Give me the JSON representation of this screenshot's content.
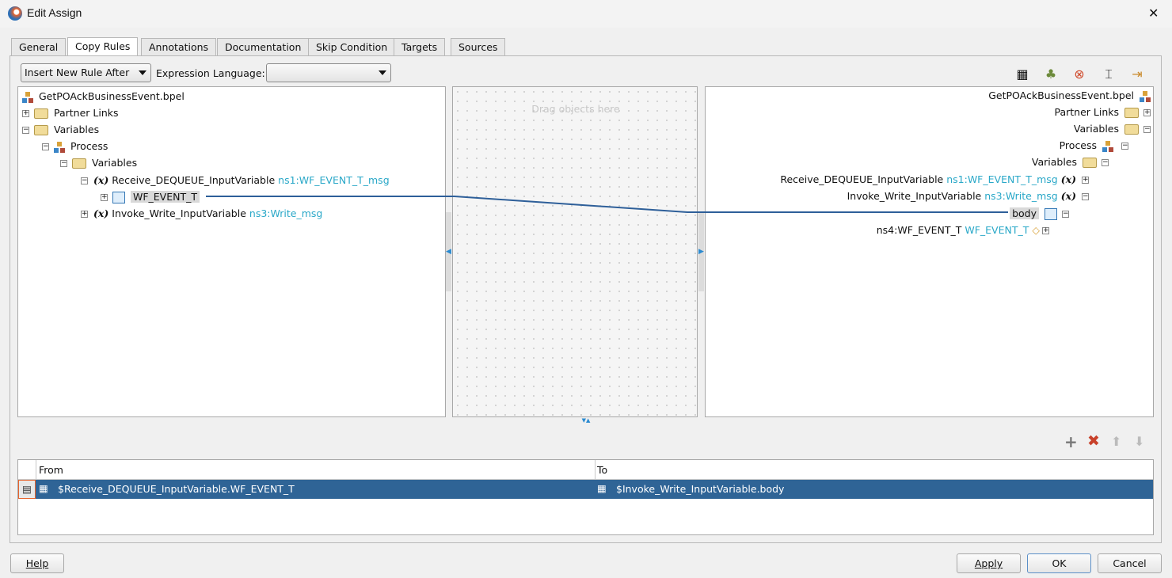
{
  "window": {
    "title": "Edit Assign",
    "close": "✕"
  },
  "tabs": [
    "General",
    "Copy Rules",
    "Annotations",
    "Documentation",
    "Skip Condition",
    "Targets",
    "Sources"
  ],
  "toolbar": {
    "insert_mode": "Insert New Rule After",
    "expr_label": "Expression Language:",
    "expr_value": ""
  },
  "source_tree": {
    "root": "GetPOAckBusinessEvent.bpel",
    "partner_links": "Partner Links",
    "variables": "Variables",
    "process": "Process",
    "process_variables": "Variables",
    "var1": {
      "name": "Receive_DEQUEUE_InputVariable",
      "type": "ns1:WF_EVENT_T_msg"
    },
    "var1_child": "WF_EVENT_T",
    "var2": {
      "name": "Invoke_Write_InputVariable",
      "type": "ns3:Write_msg"
    }
  },
  "middle": {
    "placeholder": "Drag objects here"
  },
  "target_tree": {
    "root": "GetPOAckBusinessEvent.bpel",
    "partner_links": "Partner Links",
    "variables": "Variables",
    "process": "Process",
    "process_variables": "Variables",
    "var1": {
      "name": "Receive_DEQUEUE_InputVariable",
      "type": "ns1:WF_EVENT_T_msg"
    },
    "var2": {
      "name": "Invoke_Write_InputVariable",
      "type": "ns3:Write_msg"
    },
    "var2_child": "body",
    "body_child": {
      "name": "ns4:WF_EVENT_T",
      "type": "WF_EVENT_T"
    }
  },
  "rules": {
    "columns": [
      "From",
      "To"
    ],
    "rows": [
      {
        "from": "$Receive_DEQUEUE_InputVariable.WF_EVENT_T",
        "to": "$Invoke_Write_InputVariable.body"
      }
    ]
  },
  "buttons": {
    "help": "Help",
    "apply": "Apply",
    "ok": "OK",
    "cancel": "Cancel"
  },
  "colors": {
    "selection": "#2f6496",
    "link": "#2e5f99",
    "type": "#2aa8c8"
  }
}
